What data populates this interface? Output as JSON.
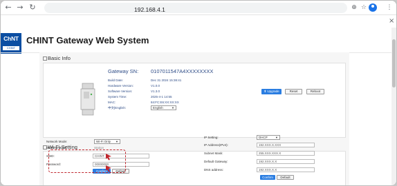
{
  "browser": {
    "url": "192.168.4.1",
    "back_icon": "←",
    "forward_icon": "→",
    "reload_icon": "↻",
    "zoom_icon": "⊕",
    "star_icon": "☆",
    "menu_icon": "⋮",
    "close_icon": "×"
  },
  "header": {
    "logo_text": "ChNT",
    "logo_sub": "CHINT",
    "title": "CHINT Gateway Web System"
  },
  "basic_info": {
    "section_title": "Basic Info",
    "sn_label": "Gateway SN:",
    "sn_value": "0107011547A4XXXXXXXX",
    "rows": [
      {
        "label": "Build Date:",
        "value": "Dec 31 2024 15:38:41"
      },
      {
        "label": "Hardware Version:",
        "value": "V1.0.0"
      },
      {
        "label": "Software Version:",
        "value": "V1.3.0"
      },
      {
        "label": "System Time:",
        "value": "2025-4-1 14:55"
      },
      {
        "label": "MAC:",
        "value": "84:FC:E6:XX:XX:XX"
      }
    ],
    "lang_label": "中文|English:",
    "lang_value": "English",
    "upgrade_label": "Upgrade",
    "reset_label": "Reset",
    "reboot_label": "Reboot"
  },
  "wifi": {
    "section_title": "Wi-Fi Setting",
    "network_mode_label": "Network Mode:",
    "network_mode_value": "Wi-Fi Only",
    "working_mode_label": "Working Mode:",
    "working_mode_value": "Station",
    "ssid_label": "SSID:",
    "ssid_value": "CHINT",
    "password_label": "Password:",
    "password_value": "00000000",
    "confirm_label": "Confirm",
    "default_label": "Default",
    "ip_setting_label": "IP Setting:",
    "ip_setting_value": "DHCP",
    "ip_address_label": "IP Address(IPv4):",
    "ip_address_value": "192.XXX.X.XXX",
    "subnet_label": "Subnet Mask:",
    "subnet_value": "255.XXX.XXX.X",
    "gateway_label": "Default Gateway:",
    "gateway_value": "192.XXX.X.X",
    "dns_label": "DNS address:",
    "dns_value": "192.XXX.X.X",
    "confirm2_label": "Confirm",
    "default2_label": "Default"
  },
  "colors": {
    "brand": "#0b4ea2",
    "accent_blue": "#2a7de1",
    "highlight_red": "#c0262d",
    "info_text": "#2d4b86"
  }
}
